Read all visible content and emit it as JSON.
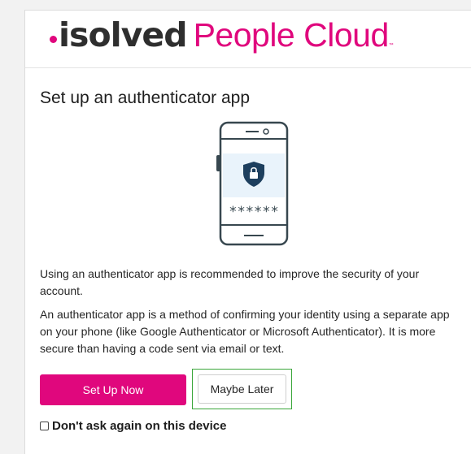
{
  "brand": {
    "name": "isolved",
    "suffix": "People Cloud",
    "trademark": "™",
    "colors": {
      "accent": "#e0077d",
      "dark": "#2e2e2e",
      "focus": "#3aa63a",
      "phone_stroke": "#37474f",
      "phone_screen": "#e9f3fb"
    }
  },
  "page": {
    "title": "Set up an authenticator app",
    "illustration": {
      "icon": "phone-lock-icon",
      "masked_code": "******"
    },
    "paragraphs": [
      "Using an authenticator app is recommended to improve the security of your account.",
      "An authenticator app is a method of confirming your identity using a separate app on your phone (like Google Authenticator or Microsoft Authenticator). It is more secure than having a code sent via email or text."
    ],
    "buttons": {
      "setup": "Set Up Now",
      "later": "Maybe Later"
    },
    "checkbox": {
      "label": "Don't ask again on this device",
      "checked": false
    }
  }
}
